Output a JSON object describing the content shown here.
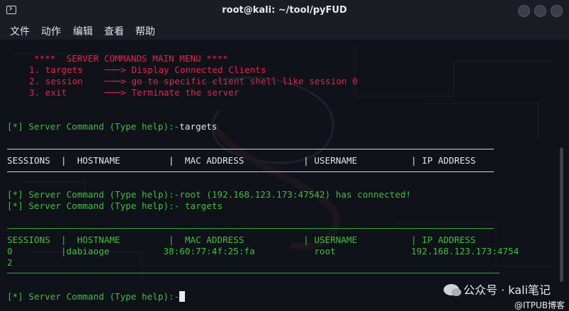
{
  "window": {
    "title": "root@kali: ~/tool/pyFUD"
  },
  "menu": [
    "文件",
    "动作",
    "编辑",
    "查看",
    "帮助"
  ],
  "terminal": {
    "menu_header": "     ****  SERVER COMMANDS MAIN MENU ****",
    "menu_items": [
      "1. targets    ───> Display Connected Clients",
      "2. session    ───> go to specific client shell like session 0",
      "3. exit       ───> Terminate the server"
    ],
    "prompt1": "[*] Server Command (Type help):-",
    "input1": "targets",
    "table_header": "SESSIONS  |  HOSTNAME         |  MAC ADDRESS           | USERNAME          | IP ADDRESS",
    "connected_msg": "[*] Server Command (Type help):-root (192.168.123.173:47542) has connected!",
    "prompt2": "[*] Server Command (Type help):- targets",
    "table2_header": "SESSIONS  |  HOSTNAME         |  MAC ADDRESS           | USERNAME          | IP ADDRESS",
    "table2_row": "0         |dabiaoge          38:60:77:4f:25:fa           root              192.168.123.173:4754",
    "table2_row_wrap": "2",
    "prompt3": "[*] Server Command (Type help):-"
  },
  "watermark": {
    "text": "公众号 · kali笔记",
    "sub": "@ITPUB博客"
  }
}
